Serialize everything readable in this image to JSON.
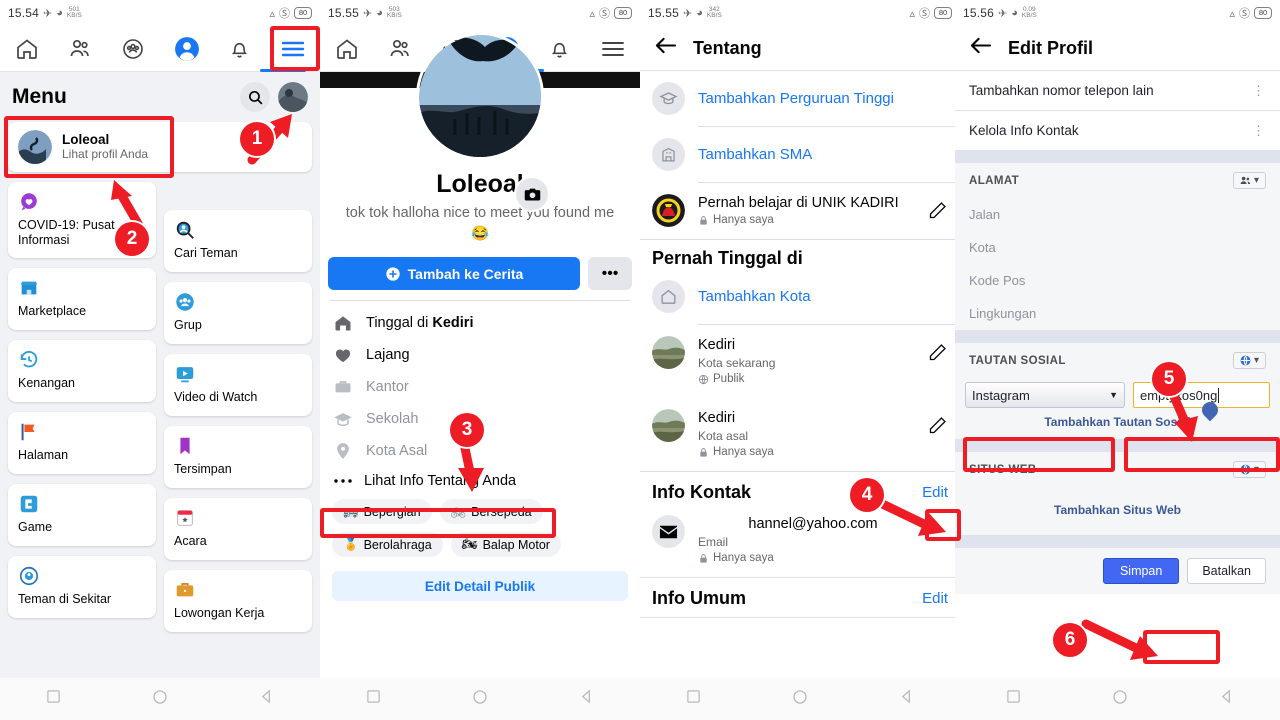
{
  "status_bars": [
    {
      "time": "15.54",
      "net_rate": "501",
      "net_unit": "KB/S",
      "battery": "80"
    },
    {
      "time": "15.55",
      "net_rate": "503",
      "net_unit": "KB/S",
      "battery": "80"
    },
    {
      "time": "15.55",
      "net_rate": "342",
      "net_unit": "KB/S",
      "battery": "80"
    },
    {
      "time": "15.56",
      "net_rate": "0.09",
      "net_unit": "KB/S",
      "battery": "80"
    }
  ],
  "fb_tabs": [
    {
      "name": "home-tab",
      "icon": "home-icon"
    },
    {
      "name": "friends-tab",
      "icon": "friends-icon"
    },
    {
      "name": "groups-tab",
      "icon": "groups-icon"
    },
    {
      "name": "profile-tab",
      "icon": "profile-icon"
    },
    {
      "name": "notifications-tab",
      "icon": "bell-icon"
    },
    {
      "name": "menu-tab",
      "icon": "hamburger-icon"
    }
  ],
  "panel1": {
    "title": "Menu",
    "search_icon": "search-icon",
    "profile": {
      "name": "Loleoal",
      "subtitle": "Lihat profil Anda"
    },
    "left_items": [
      {
        "label": "COVID-19: Pusat Informasi",
        "icon": "covid-heart-icon"
      },
      {
        "label": "Marketplace",
        "icon": "marketplace-icon"
      },
      {
        "label": "Kenangan",
        "icon": "memories-clock-icon"
      },
      {
        "label": "Halaman",
        "icon": "pages-flag-icon"
      },
      {
        "label": "Game",
        "icon": "gaming-icon"
      },
      {
        "label": "Teman di Sekitar",
        "icon": "nearby-friends-icon"
      }
    ],
    "right_items": [
      {
        "label": "Cari Teman",
        "icon": "find-friends-icon"
      },
      {
        "label": "Grup",
        "icon": "groups-icon"
      },
      {
        "label": "Video di Watch",
        "icon": "watch-video-icon"
      },
      {
        "label": "Tersimpan",
        "icon": "saved-bookmark-icon"
      },
      {
        "label": "Acara",
        "icon": "events-calendar-icon"
      },
      {
        "label": "Lowongan Kerja",
        "icon": "jobs-briefcase-icon"
      }
    ]
  },
  "panel2": {
    "name": "Loleoal",
    "bio": "tok tok halloha nice to meet you found me😂",
    "add_story_label": "Tambah ke Cerita",
    "more_label": "•••",
    "camera_icon": "camera-icon",
    "details": [
      {
        "text": "Tinggal di ",
        "bold": "Kediri",
        "icon": "home-icon",
        "muted": false
      },
      {
        "text": "Lajang",
        "bold": "",
        "icon": "heart-icon",
        "muted": false
      },
      {
        "text": "Kantor",
        "bold": "",
        "icon": "briefcase-icon",
        "muted": true
      },
      {
        "text": "Sekolah",
        "bold": "",
        "icon": "school-icon",
        "muted": true
      },
      {
        "text": "Kota Asal",
        "bold": "",
        "icon": "pin-icon",
        "muted": true
      }
    ],
    "see_more": "Lihat Info Tentang Anda",
    "chips": [
      {
        "label": "Bepergian",
        "emoji": "🚌"
      },
      {
        "label": "Bersepeda",
        "emoji": "🚲"
      },
      {
        "label": "Berolahraga",
        "emoji": "🏅"
      },
      {
        "label": "Balap Motor",
        "emoji": "🏍"
      }
    ],
    "edit_public": "Edit Detail Publik"
  },
  "panel3": {
    "title": "Tentang",
    "back_icon": "back-arrow-icon",
    "rows": [
      {
        "type": "link",
        "label": "Tambahkan Perguruan Tinggi",
        "icon": "graduation-cap-icon"
      },
      {
        "type": "link",
        "label": "Tambahkan SMA",
        "icon": "school-building-icon"
      },
      {
        "type": "entry",
        "title": "Pernah belajar di UNIK KADIRI",
        "sub": "",
        "privacy": "Hanya saya",
        "privacy_icon": "lock-icon",
        "thumb": "unik-kadiri-logo"
      }
    ],
    "section_lived": "Pernah Tinggal di",
    "lived_rows": [
      {
        "type": "link",
        "label": "Tambahkan Kota",
        "icon": "home-outline-icon"
      },
      {
        "type": "entry",
        "title": "Kediri",
        "sub": "Kota sekarang",
        "privacy": "Publik",
        "privacy_icon": "globe-icon",
        "thumb": "kediri-photo"
      },
      {
        "type": "entry",
        "title": "Kediri",
        "sub": "Kota asal",
        "privacy": "Hanya saya",
        "privacy_icon": "lock-icon",
        "thumb": "kediri-photo"
      }
    ],
    "section_contact": "Info Kontak",
    "contact_edit": "Edit",
    "email_value": "hannel@yahoo.com",
    "email_label": "Email",
    "email_privacy": "Hanya saya",
    "section_general": "Info Umum",
    "general_edit": "Edit"
  },
  "panel4": {
    "title": "Edit Profil",
    "back_icon": "back-arrow-icon",
    "rows": [
      {
        "label": "Tambahkan nomor telepon lain"
      },
      {
        "label": "Kelola Info Kontak"
      }
    ],
    "address_section": "ALAMAT",
    "address_fields": [
      "Jalan",
      "Kota",
      "Kode Pos",
      "Lingkungan"
    ],
    "social_section": "TAUTAN SOSIAL",
    "social_select_value": "Instagram",
    "social_input_value": "emptykos0ng",
    "social_add_label": "Tambahkan Tautan Sosial",
    "website_section": "SITUS WEB",
    "website_add_label": "Tambahkan Situs Web",
    "save_label": "Simpan",
    "cancel_label": "Batalkan",
    "audience_icon_people": "people-audience-icon",
    "audience_icon_globe": "globe-audience-icon"
  },
  "annotations": [
    {
      "number": "1"
    },
    {
      "number": "2"
    },
    {
      "number": "3"
    },
    {
      "number": "4"
    },
    {
      "number": "5"
    },
    {
      "number": "6"
    }
  ],
  "android_nav": [
    {
      "icon": "recents-square-icon"
    },
    {
      "icon": "home-circle-icon"
    },
    {
      "icon": "back-triangle-icon"
    }
  ],
  "colors": {
    "fb_blue": "#1877f2",
    "annotation_red": "#ee1c25",
    "link_blue": "#3b5998",
    "text_primary": "#050505",
    "text_secondary": "#65676b"
  }
}
